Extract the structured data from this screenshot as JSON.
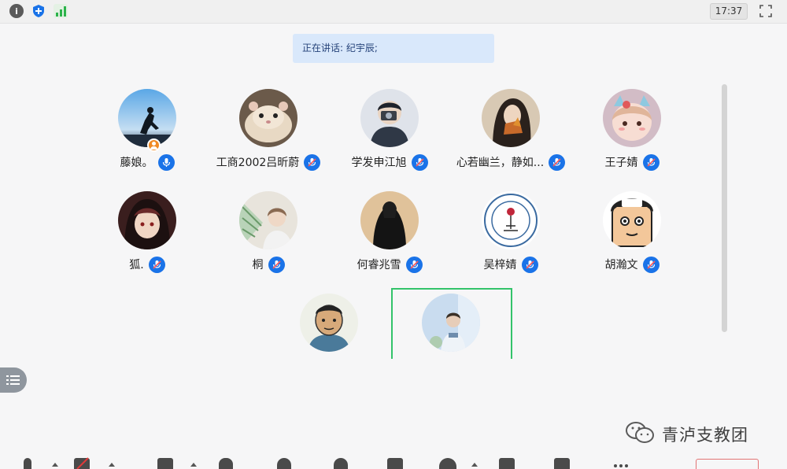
{
  "topbar": {
    "icons": [
      "info-icon",
      "shield-icon",
      "signal-icon"
    ],
    "time": "17:37",
    "fullscreen_icon": "fullscreen-icon"
  },
  "speaking": {
    "text": "正在讲话: 纪宇辰;"
  },
  "participants": [
    {
      "name": "藤娘。",
      "host": true
    },
    {
      "name": "工商2002吕昕蔚"
    },
    {
      "name": "学发申江旭"
    },
    {
      "name": "心若幽兰，静如..."
    },
    {
      "name": "王子婧"
    },
    {
      "name": "狐."
    },
    {
      "name": "桐"
    },
    {
      "name": "何睿兆雪"
    },
    {
      "name": "吴梓婧"
    },
    {
      "name": "胡瀚文"
    },
    {
      "name": ""
    },
    {
      "name": ""
    }
  ],
  "watermark": {
    "text": "青泸支教团",
    "icon": "wechat-icon"
  },
  "colors": {
    "mic_blue": "#1a73e8",
    "active_green": "#33c36a",
    "banner_bg": "#d9e8fb",
    "host_orange": "#f08a24"
  },
  "toolbar": {
    "icons": [
      "mic-icon",
      "camera-off-icon",
      "share-icon",
      "security-icon",
      "participants-icon",
      "invite-icon",
      "chat-icon",
      "record-icon",
      "apps-icon",
      "video-play-icon",
      "more-icon"
    ]
  }
}
